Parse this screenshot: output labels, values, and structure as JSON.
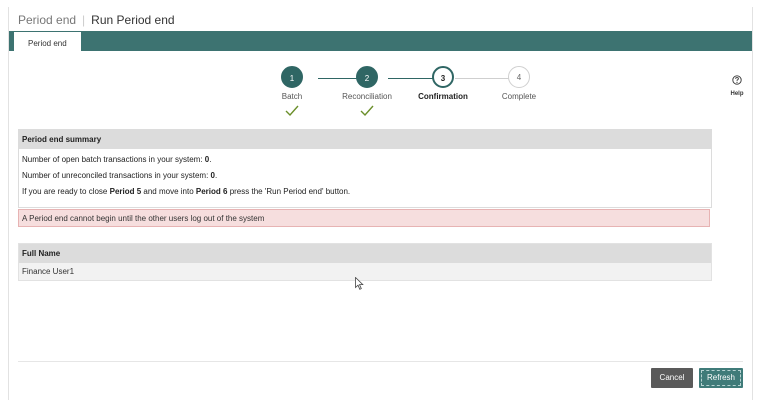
{
  "header": {
    "breadcrumb_parent": "Period end",
    "page_title": "Run Period end"
  },
  "tabs": [
    {
      "label": "Period end",
      "active": true
    }
  ],
  "stepper": {
    "steps": [
      {
        "number": "1",
        "label": "Batch",
        "state": "done"
      },
      {
        "number": "2",
        "label": "Reconciliation",
        "state": "done"
      },
      {
        "number": "3",
        "label": "Confirmation",
        "state": "current"
      },
      {
        "number": "4",
        "label": "Complete",
        "state": "todo"
      }
    ]
  },
  "help": {
    "label": "Help",
    "icon": "question-circle-icon"
  },
  "summary": {
    "title": "Period end summary",
    "open_batch_prefix": "Number of open batch transactions in your system: ",
    "open_batch_value": "0",
    "unreconciled_prefix": "Number of unreconciled transactions in your system: ",
    "unreconciled_value": "0",
    "ready_prefix": "If you are ready to close ",
    "close_period": "Period 5",
    "ready_middle": " and move into ",
    "next_period": "Period 6",
    "ready_suffix": " press the 'Run Period end' button."
  },
  "alert": {
    "message": "A Period end cannot begin until the other users log out of the system"
  },
  "users_table": {
    "header": "Full Name",
    "rows": [
      "Finance User1"
    ]
  },
  "footer": {
    "cancel_label": "Cancel",
    "refresh_label": "Refresh"
  },
  "colors": {
    "brand": "#3d7371",
    "step_done": "#2f6664",
    "alert_bg": "#f6dede",
    "cancel_bg": "#5a5a5a",
    "refresh_bg": "#3f7b79",
    "check": "#6b8f2a"
  }
}
